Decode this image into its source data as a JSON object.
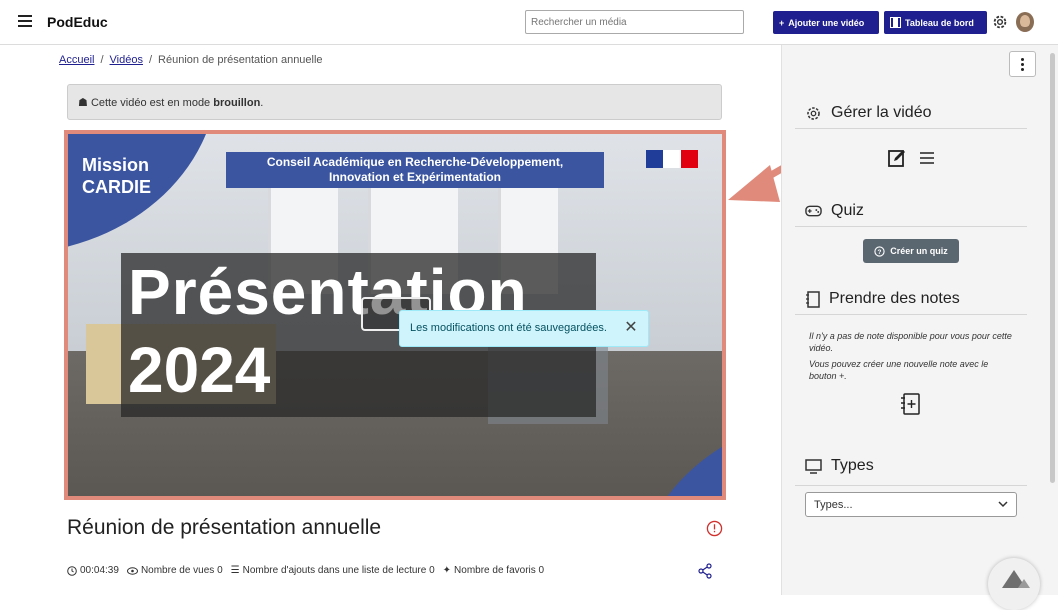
{
  "navbar": {
    "brand": "PodEduc",
    "search_placeholder": "Rechercher un média",
    "add_video_label": "Ajouter une vidéo",
    "dashboard_label": "Tableau de bord"
  },
  "breadcrumb": {
    "home": "Accueil",
    "videos": "Vidéos",
    "current": "Réunion de présentation annuelle"
  },
  "draft_notice": {
    "prefix": "Cette vidéo est en mode",
    "status": "brouillon",
    "suffix": "."
  },
  "video_frame": {
    "logo_line1": "Mission",
    "logo_line2": "CARDIE",
    "banner_line1": "Conseil Académique en Recherche-Développement,",
    "banner_line2": "Innovation et Expérimentation",
    "title_line1": "Présentation",
    "title_line2": "2024"
  },
  "toast": {
    "message": "Les modifications ont été sauvegardées."
  },
  "video": {
    "title": "Réunion de présentation annuelle",
    "duration": "00:04:39",
    "views_label": "Nombre de vues 0",
    "playlist_label": "Nombre d'ajouts dans une liste de lecture 0",
    "favorites_label": "Nombre de favoris 0"
  },
  "sidebar": {
    "manage_title": "Gérer la vidéo",
    "quiz_title": "Quiz",
    "create_quiz_label": "Créer un quiz",
    "notes_title": "Prendre des notes",
    "notes_empty_line1": "Il n'y a pas de note disponible pour vous pour cette vidéo.",
    "notes_empty_line2": "Vous pouvez créer une nouvelle note avec le bouton +.",
    "types_title": "Types",
    "types_placeholder": "Types..."
  },
  "colors": {
    "brand": "#1f1f8f",
    "highlight": "#e08a7b",
    "toast_bg": "#cff4fc",
    "video_blue": "#3b55a0"
  }
}
